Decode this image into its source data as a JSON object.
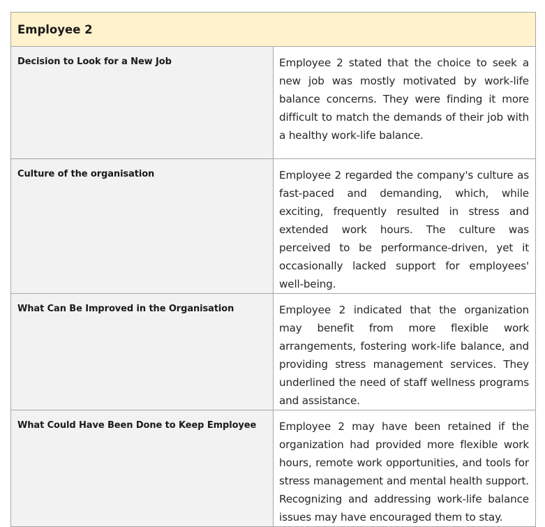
{
  "table": {
    "title": "Employee 2",
    "rows": [
      {
        "label": "Decision to Look for a New Job",
        "text": "Employee 2 stated that the choice to seek a new job was mostly motivated by work-life balance concerns. They were finding it more difficult to match the demands of their job with a healthy work-life balance."
      },
      {
        "label": "Culture of the organisation",
        "text": "Employee 2 regarded the company's culture as fast-paced and demanding, which, while exciting, frequently resulted in stress and extended work hours. The culture was perceived to be performance-driven, yet it occasionally lacked support for employees' well-being."
      },
      {
        "label": "What Can Be Improved in the Organisation",
        "text": "Employee 2 indicated that the organization may benefit from more flexible work arrangements, fostering work-life balance, and providing stress management services. They underlined the need of staff wellness programs and assistance."
      },
      {
        "label": "What Could Have Been Done to Keep Employee",
        "text": "Employee 2 may have been retained if the organization had provided more flexible work hours, remote work opportunities, and tools for stress management and mental health support. Recognizing and addressing work-life balance issues may have encouraged them to stay."
      }
    ]
  },
  "colors": {
    "header_background": "#fff2cc",
    "label_background": "#f2f2f2",
    "border": "#a6a6a6"
  }
}
